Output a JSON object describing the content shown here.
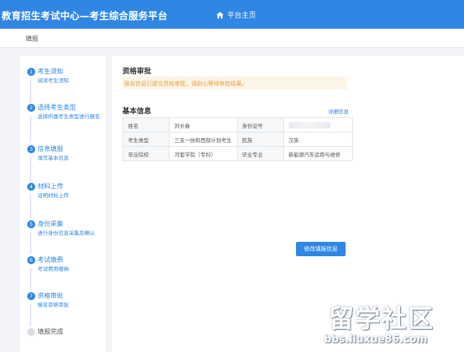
{
  "header": {
    "title": "教育招生考试中心—考生综合服务平台",
    "home_icon": "home-icon",
    "home_label": "平台主页"
  },
  "breadcrumb": "填报",
  "steps": [
    {
      "num": "1",
      "label": "考生须知",
      "desc": "阅读考生须知"
    },
    {
      "num": "2",
      "label": "选择考生类型",
      "desc": "选择所属考生类型进行报名"
    },
    {
      "num": "3",
      "label": "信息填报",
      "desc": "填写基本信息"
    },
    {
      "num": "4",
      "label": "材料上传",
      "desc": "证明材料上传"
    },
    {
      "num": "5",
      "label": "身份采集",
      "desc": "进行身份信息采集及确认"
    },
    {
      "num": "6",
      "label": "考试缴费",
      "desc": "考试费用缴纳"
    },
    {
      "num": "7",
      "label": "资格审批",
      "desc": "报名资格审批"
    },
    {
      "num": "",
      "label": "填报完成",
      "desc": ""
    }
  ],
  "review": {
    "title": "资格审批",
    "notice": "报名信息已提交资格审批，请耐心等待审批结果。"
  },
  "basic_info": {
    "title": "基本信息",
    "detail_link": "详细信息",
    "rows": [
      {
        "k1": "姓名",
        "v1": "刘长春",
        "k2": "身份证号",
        "v2": ""
      },
      {
        "k1": "考生类型",
        "v1": "三支一扶和西部计划考生",
        "k2": "民族",
        "v2": "汉族"
      },
      {
        "k1": "毕业院校",
        "v1": "河套学院（专科）",
        "k2": "毕业专业",
        "v2": "新能源汽车运用与维修"
      }
    ]
  },
  "edit_button": "修改填报信息",
  "watermark": {
    "main": "留学社区",
    "url": "bbs.liuxue86.com"
  },
  "colors": {
    "primary": "#2f86e4",
    "notice_bg": "#fdf4e8",
    "notice_text": "#e9a23b",
    "page_bg": "#f2f4f7"
  }
}
